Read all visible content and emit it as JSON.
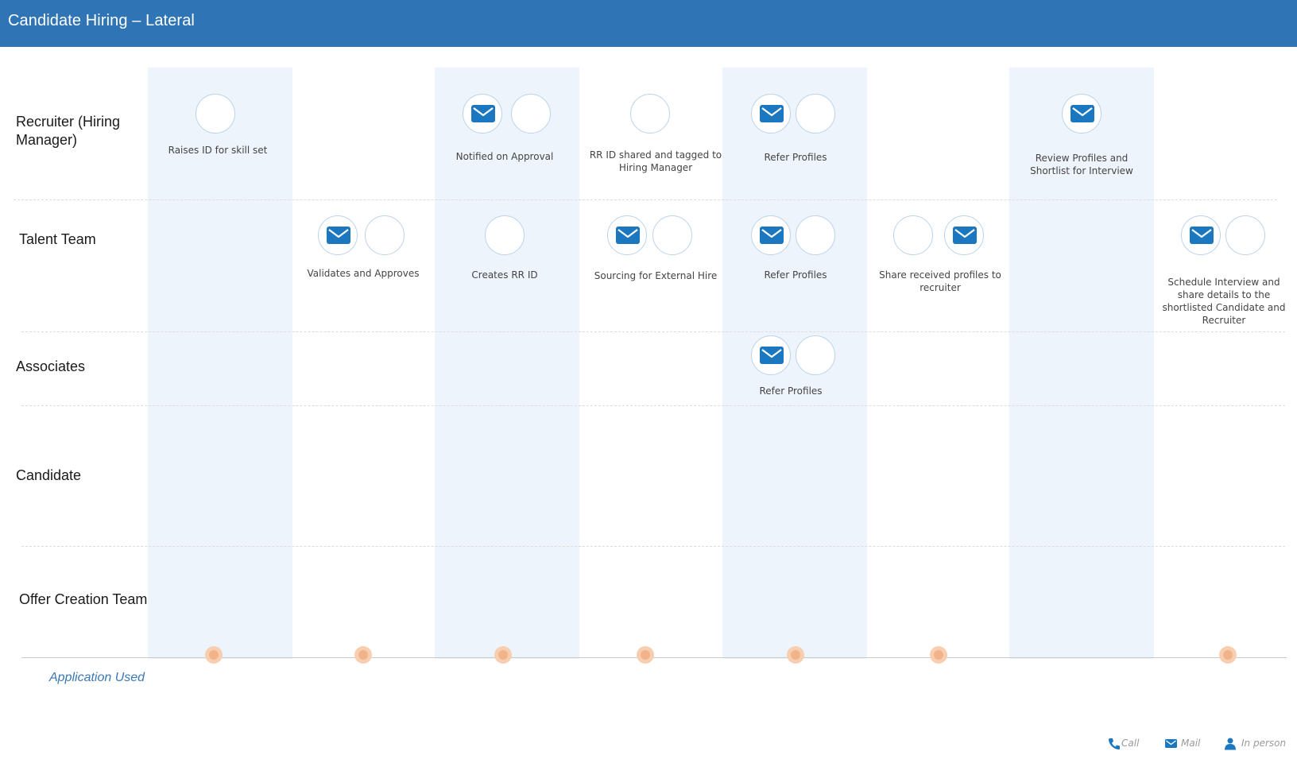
{
  "header": {
    "title": "Candidate Hiring – Lateral"
  },
  "lanes": [
    "Recruiter (Hiring Manager)",
    "Talent Team",
    "Associates",
    "Candidate",
    "Offer Creation Team"
  ],
  "steps": {
    "raises_id": "Raises ID for skill set",
    "validates": "Validates and Approves",
    "notified": "Notified on Approval",
    "creates_rr": "Creates RR ID",
    "rr_shared": "RR ID shared and tagged to Hiring Manager",
    "sourcing": "Sourcing for External Hire",
    "refer_recruiter": "Refer Profiles",
    "refer_talent": "Refer Profiles",
    "refer_associates": "Refer Profiles",
    "share_received": "Share received profiles to recruiter",
    "review": "Review Profiles and Shortlist for Interview",
    "schedule": "Schedule Interview and share details to the shortlisted Candidate and Recruiter"
  },
  "footer": {
    "application_used": "Application Used"
  },
  "legend": {
    "call": "Call",
    "mail": "Mail",
    "in_person": "In person"
  },
  "icons": {
    "mail": "mail-icon",
    "call": "phone-icon",
    "in_person": "person-icon"
  },
  "colors": {
    "header": "#2f75b5",
    "band": "#edf4fb",
    "icon": "#1b78c0",
    "dot": "#f2b38a"
  }
}
